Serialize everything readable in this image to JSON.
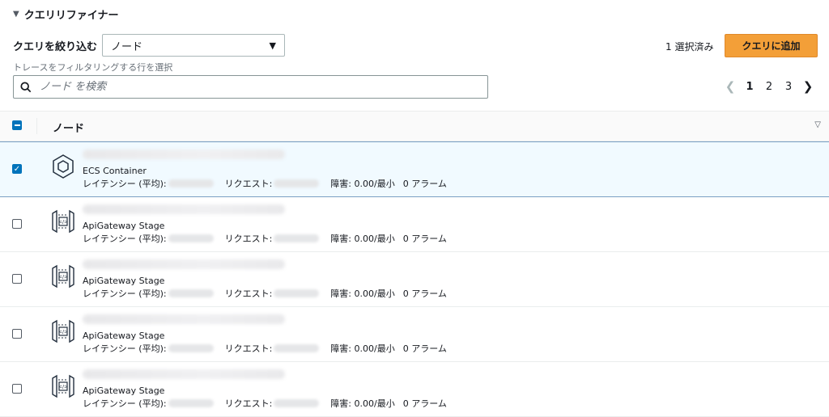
{
  "section": {
    "title": "クエリリファイナー"
  },
  "filter": {
    "label": "クエリを絞り込む",
    "select_value": "ノード",
    "hint": "トレースをフィルタリングする行を選択"
  },
  "selection": {
    "count_text": "1 選択済み",
    "add_button": "クエリに追加"
  },
  "search": {
    "placeholder": "ノード を検索"
  },
  "pagination": {
    "pages": [
      "1",
      "2",
      "3"
    ],
    "current": "1"
  },
  "table": {
    "header": "ノード",
    "rows": [
      {
        "type": "ECS Container",
        "icon": "ecs-container-icon",
        "selected": true,
        "latency_label": "レイテンシー (平均):",
        "requests_label": "リクエスト:",
        "faults": "障害: 0.00/最小",
        "alarms": "0 アラーム"
      },
      {
        "type": "ApiGateway Stage",
        "icon": "api-gateway-icon",
        "selected": false,
        "latency_label": "レイテンシー (平均):",
        "requests_label": "リクエスト:",
        "faults": "障害: 0.00/最小",
        "alarms": "0 アラーム"
      },
      {
        "type": "ApiGateway Stage",
        "icon": "api-gateway-icon",
        "selected": false,
        "latency_label": "レイテンシー (平均):",
        "requests_label": "リクエスト:",
        "faults": "障害: 0.00/最小",
        "alarms": "0 アラーム"
      },
      {
        "type": "ApiGateway Stage",
        "icon": "api-gateway-icon",
        "selected": false,
        "latency_label": "レイテンシー (平均):",
        "requests_label": "リクエスト:",
        "faults": "障害: 0.00/最小",
        "alarms": "0 アラーム"
      },
      {
        "type": "ApiGateway Stage",
        "icon": "api-gateway-icon",
        "selected": false,
        "latency_label": "レイテンシー (平均):",
        "requests_label": "リクエスト:",
        "faults": "障害: 0.00/最小",
        "alarms": "0 アラーム"
      }
    ]
  },
  "colors": {
    "accent": "#f39f38",
    "checkbox": "#0073bb",
    "selected_row": "#f1faff"
  }
}
